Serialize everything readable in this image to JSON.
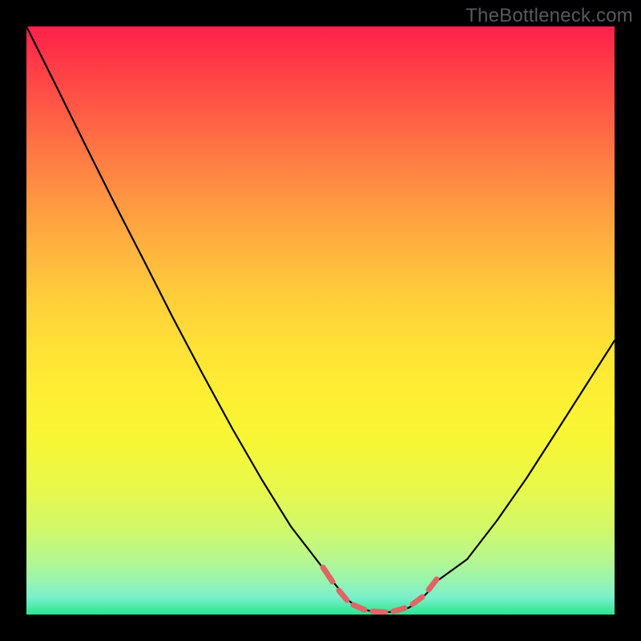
{
  "watermark": "TheBottleneck.com",
  "chart_data": {
    "type": "line",
    "title": "",
    "xlabel": "",
    "ylabel": "",
    "x": [
      0.0,
      0.05,
      0.1,
      0.15,
      0.2,
      0.25,
      0.3,
      0.35,
      0.4,
      0.45,
      0.5,
      0.55,
      0.6,
      0.63,
      0.66,
      0.7,
      0.75,
      0.8,
      0.85,
      0.9,
      0.95,
      1.0
    ],
    "values": [
      1.0,
      0.9,
      0.8,
      0.7,
      0.6,
      0.5,
      0.4,
      0.3,
      0.2,
      0.11,
      0.045,
      0.015,
      0.005,
      0.004,
      0.005,
      0.013,
      0.045,
      0.1,
      0.17,
      0.26,
      0.36,
      0.47
    ],
    "xlim": [
      0,
      1
    ],
    "ylim": [
      0,
      1
    ],
    "highlight_region": {
      "x_start": 0.5,
      "x_end": 0.68,
      "style": "red-dash"
    },
    "background_gradient": [
      "#ff1f4a",
      "#ffcd3b",
      "#feee33",
      "#2be58e"
    ]
  }
}
